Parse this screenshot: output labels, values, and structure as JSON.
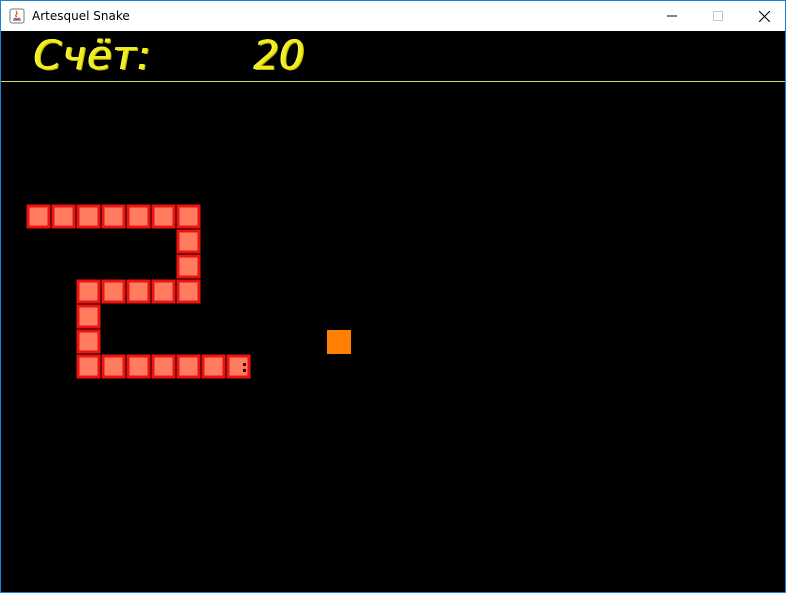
{
  "window": {
    "title": "Artesquel Snake",
    "controls": [
      "minimize",
      "maximize",
      "close"
    ]
  },
  "score": {
    "label": "Счёт:",
    "value": "20"
  },
  "colors": {
    "background": "#000000",
    "score_text": "#f1ee1f",
    "snake_fill": "#ff7d5e",
    "snake_border": "#ee1212",
    "food": "#ff7f00",
    "divider": "#d8d36a"
  },
  "game": {
    "cell_units": "grid cells",
    "snake": {
      "direction": "right",
      "head": [
        9,
        13
      ],
      "body": [
        [
          9,
          13
        ],
        [
          8,
          13
        ],
        [
          7,
          13
        ],
        [
          6,
          13
        ],
        [
          5,
          13
        ],
        [
          4,
          13
        ],
        [
          3,
          13
        ],
        [
          3,
          12
        ],
        [
          3,
          11
        ],
        [
          3,
          10
        ],
        [
          4,
          10
        ],
        [
          5,
          10
        ],
        [
          6,
          10
        ],
        [
          7,
          10
        ],
        [
          7,
          9
        ],
        [
          7,
          8
        ],
        [
          7,
          7
        ],
        [
          6,
          7
        ],
        [
          5,
          7
        ],
        [
          4,
          7
        ],
        [
          3,
          7
        ],
        [
          2,
          7
        ],
        [
          1,
          7
        ]
      ]
    },
    "food": [
      13,
      12
    ]
  }
}
